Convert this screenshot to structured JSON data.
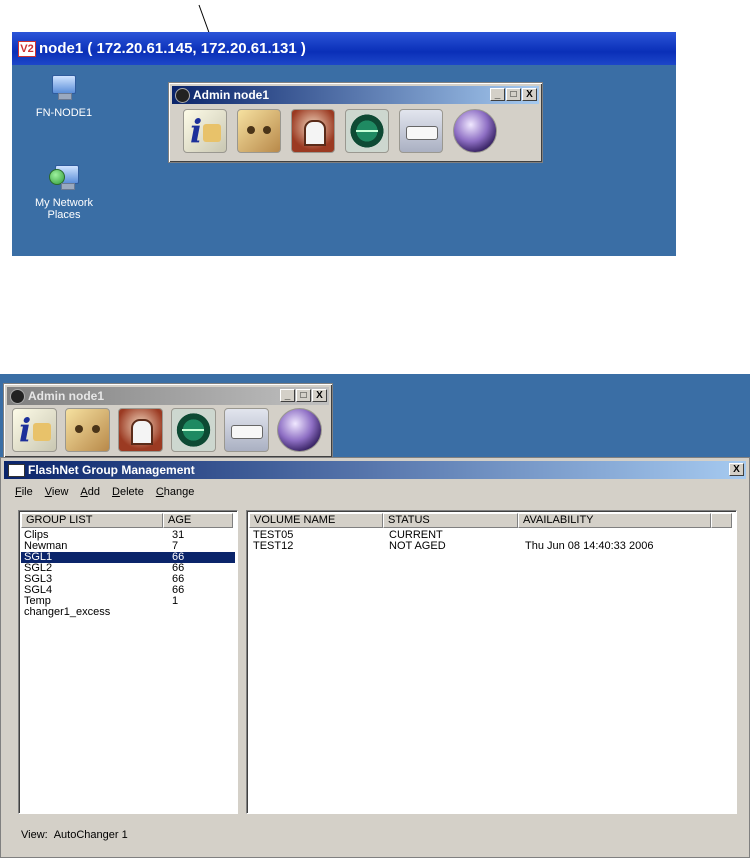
{
  "top": {
    "vnc_title": "node1 ( 172.20.61.145, 172.20.61.131 )",
    "vnc_logo": "V2",
    "desktop_icons": [
      {
        "label": "FN-NODE1",
        "icon": "computer-icon"
      },
      {
        "label": "My Network Places",
        "icon": "network-places-icon"
      }
    ],
    "admin_window": {
      "title": "Admin node1",
      "buttons": [
        "_",
        "□",
        "X"
      ],
      "icons": [
        "info-icon",
        "tape-icon",
        "archive-icon",
        "monitor-icon",
        "drive-icon",
        "sphere-icon"
      ]
    }
  },
  "bottom": {
    "admin_window": {
      "title": "Admin node1",
      "buttons": [
        "_",
        "□",
        "X"
      ]
    },
    "flashnet": {
      "title": "FlashNet Group Management",
      "close": "X",
      "menu": [
        "File",
        "View",
        "Add",
        "Delete",
        "Change"
      ],
      "group_list": {
        "headers": [
          "GROUP LIST",
          "AGE"
        ],
        "rows": [
          {
            "name": "Clips",
            "age": "31"
          },
          {
            "name": "Newman",
            "age": "7"
          },
          {
            "name": "SGL1",
            "age": "66",
            "selected": true
          },
          {
            "name": "SGL2",
            "age": "66"
          },
          {
            "name": "SGL3",
            "age": "66"
          },
          {
            "name": "SGL4",
            "age": "66"
          },
          {
            "name": "Temp",
            "age": "1"
          },
          {
            "name": "changer1_excess",
            "age": ""
          }
        ]
      },
      "volume_list": {
        "headers": [
          "VOLUME NAME",
          "STATUS",
          "AVAILABILITY"
        ],
        "rows": [
          {
            "volume": "TEST05",
            "status": "CURRENT",
            "availability": ""
          },
          {
            "volume": "TEST12",
            "status": "NOT AGED",
            "availability": "Thu Jun 08 14:40:33 2006"
          }
        ]
      },
      "status": {
        "label": "View:",
        "value": "AutoChanger 1"
      }
    }
  },
  "colors": {
    "desktop": "#3a6ea5",
    "titlebar_active": "#0a246a",
    "selection": "#0a246a",
    "window_face": "#d4d0c8"
  }
}
